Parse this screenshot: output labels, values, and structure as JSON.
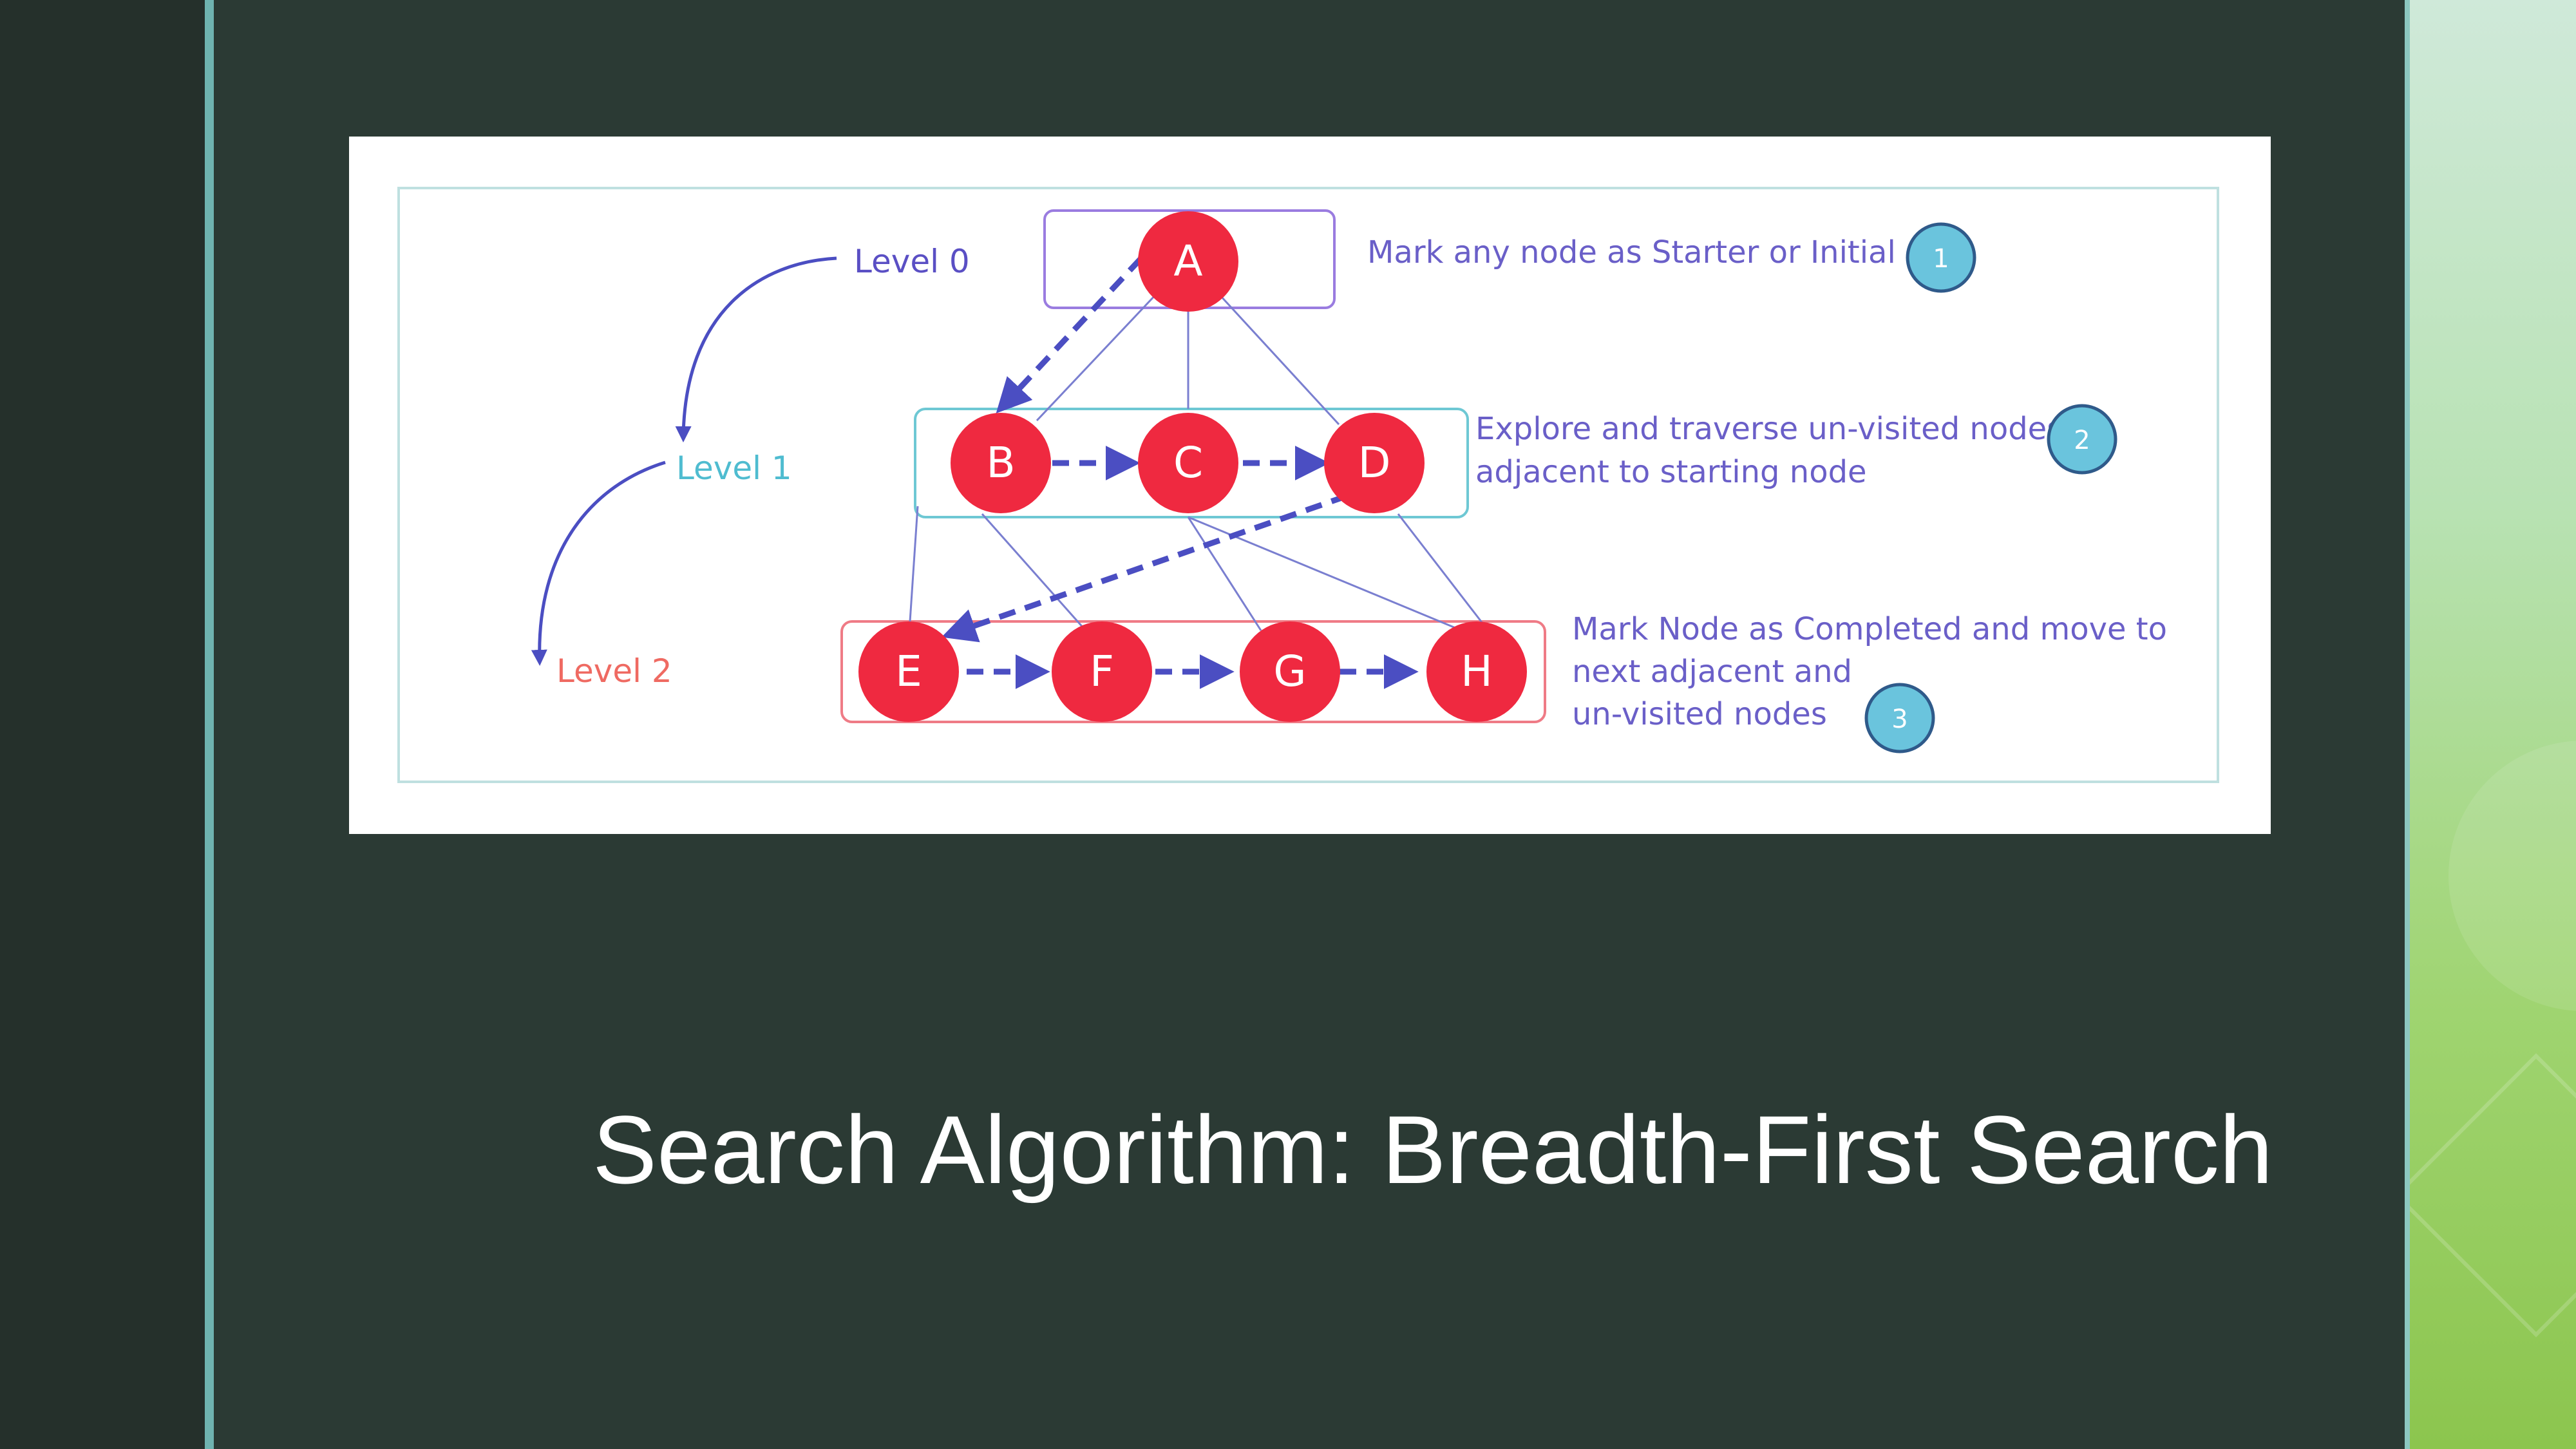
{
  "slide": {
    "title": "Search Algorithm: Breadth-First Search"
  },
  "diagram": {
    "levels": [
      {
        "label": "Level 0",
        "color": "#5a4fc4"
      },
      {
        "label": "Level 1",
        "color": "#4fbcd0"
      },
      {
        "label": "Level 2",
        "color": "#ef6a62"
      }
    ],
    "nodes": [
      "A",
      "B",
      "C",
      "D",
      "E",
      "F",
      "G",
      "H"
    ],
    "steps": [
      {
        "number": "1",
        "lines": [
          "Mark any node as Starter or Initial"
        ]
      },
      {
        "number": "2",
        "lines": [
          "Explore and traverse un-visited nodes",
          "adjacent to starting node"
        ]
      },
      {
        "number": "3",
        "lines": [
          "Mark Node as Completed and move to",
          "next adjacent and",
          "un-visited nodes"
        ]
      }
    ],
    "colors": {
      "node_fill": "#ef2940",
      "arrow": "#4b4ec2",
      "edge": "#7a7fd0",
      "step_badge": "#6ac4dd",
      "level0_box": "#9a7ce0",
      "level1_box": "#6ec8d4",
      "level2_box": "#ef7b86",
      "frame": "#bfe0e0"
    }
  }
}
